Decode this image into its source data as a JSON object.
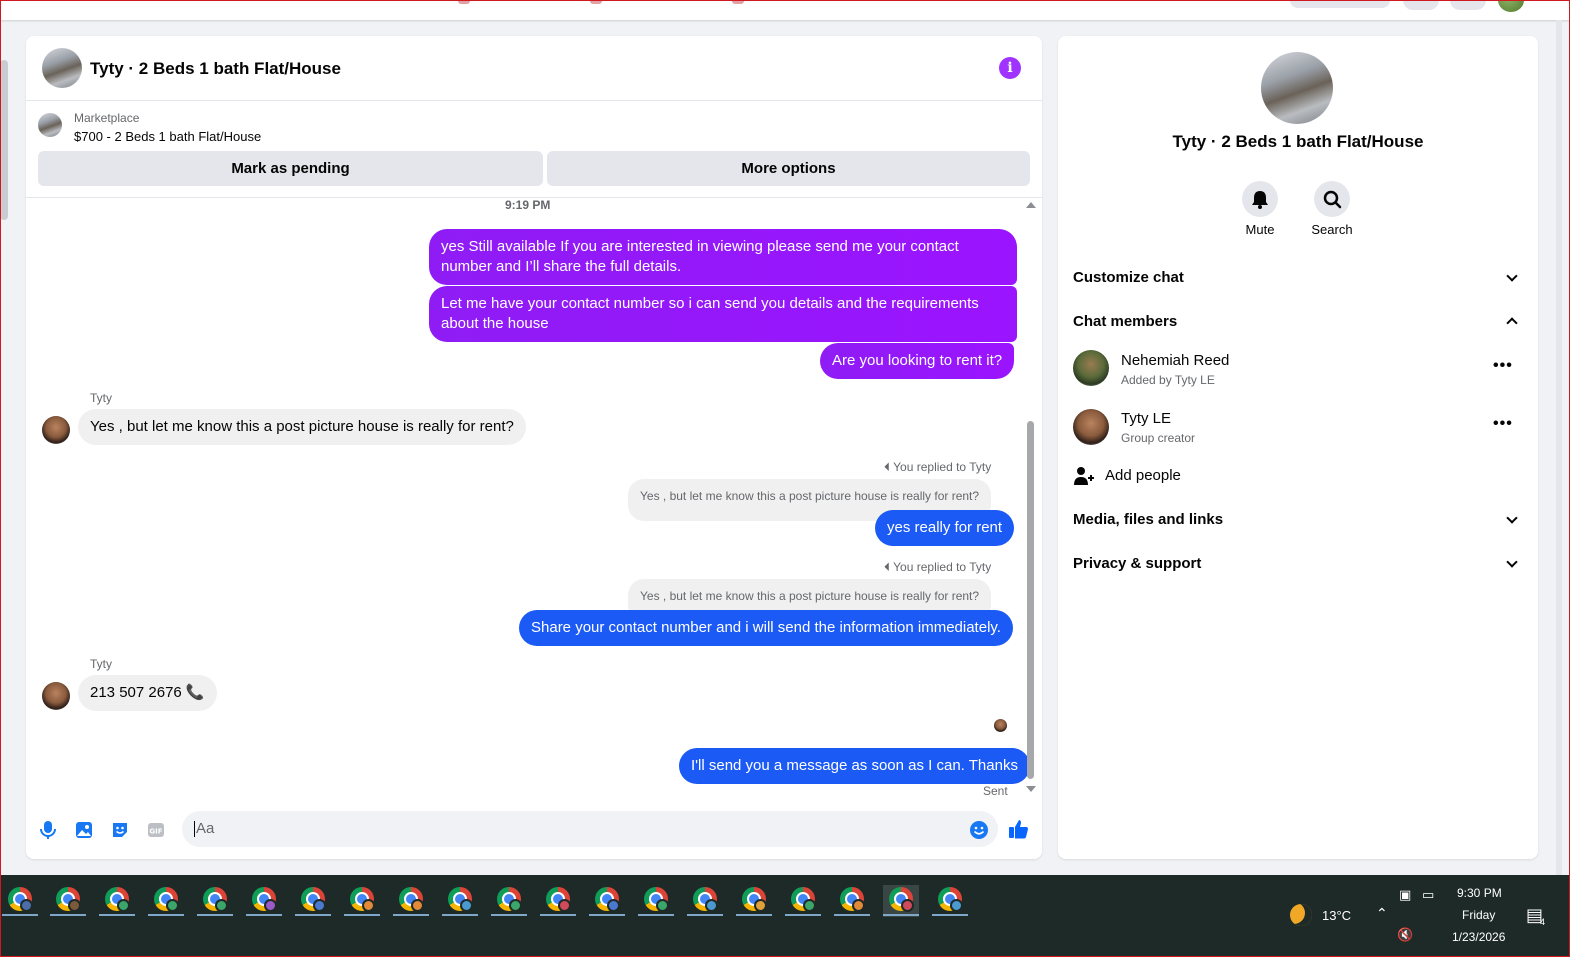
{
  "chat": {
    "title": "Tyty · 2 Beds 1 bath Flat/House",
    "marketplace_label": "Marketplace",
    "listing": "$700 - 2 Beds 1 bath Flat/House",
    "mark_pending_label": "Mark as pending",
    "more_options_label": "More options",
    "timestamp": "9:19 PM",
    "messages": {
      "m1_line1": "yes Still available If you are interested in viewing please send me your contact",
      "m1_line2": "number and I’ll share the full details.",
      "m2_line1": "Let me have your contact number so i can send you details and the requirements",
      "m2_line2": "about the house",
      "m3": "Are you looking to rent it?",
      "sender1": "Tyty",
      "m4": "Yes , but let me know this a post picture house is really for rent?",
      "replied1": "You replied to Tyty",
      "quote1": "Yes , but let me know this a post picture house is really for rent?",
      "m5": "yes  really for rent",
      "replied2": "You replied to Tyty",
      "quote2": "Yes , but let me know this a post picture house is really for rent?",
      "m6": "Share your contact number and i will send the information immediately.",
      "sender2": "Tyty",
      "m7": "213 507 2676 📞",
      "m8": "I'll send you a message as soon as I can. Thanks",
      "sent": "Sent"
    },
    "composer_placeholder": "Aa"
  },
  "side": {
    "title": "Tyty · 2 Beds 1 bath Flat/House",
    "mute_label": "Mute",
    "search_label": "Search",
    "customize_chat": "Customize chat",
    "chat_members": "Chat members",
    "members": [
      {
        "name": "Nehemiah Reed",
        "sub": "Added by Tyty LE"
      },
      {
        "name": "Tyty LE",
        "sub": "Group creator"
      }
    ],
    "add_people": "Add people",
    "media": "Media, files and links",
    "privacy": "Privacy & support"
  },
  "taskbar": {
    "temperature": "13°C",
    "time": "9:30 PM",
    "day": "Friday",
    "date": "1/23/2026",
    "notifications": "4"
  },
  "colors": {
    "accent_purple": "#9013fe",
    "bubble_blue": "#1b5af5",
    "info_icon": "#a033ff",
    "like_blue": "#0866ff"
  }
}
